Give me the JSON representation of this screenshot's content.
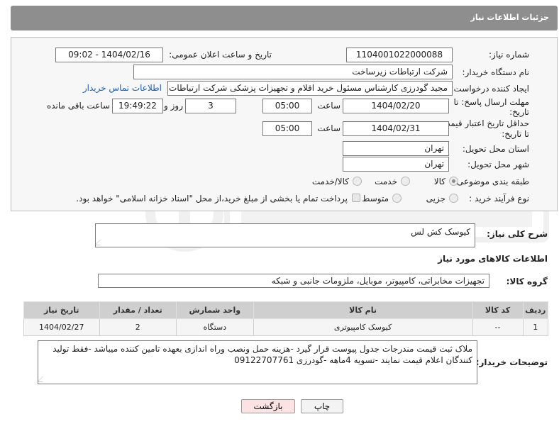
{
  "header": {
    "title": "جزئیات اطلاعات نیاز"
  },
  "form": {
    "need_number_label": "شماره نیاز:",
    "need_number": "1104001022000088",
    "announce_label": "تاریخ و ساعت اعلان عمومی:",
    "announce_value": "1404/02/16 - 09:02",
    "buyer_org_label": "نام دستگاه خریدار:",
    "buyer_org": "شرکت ارتباطات زیرساخت",
    "creator_label": "ایجاد کننده درخواست:",
    "creator": "مجید گودرزی کارشناس مسئول خرید اقلام و تجهیزات پزشکی شرکت ارتباطات ز",
    "contact_link": "اطلاعات تماس خریدار",
    "reply_deadline_label_1": "مهلت ارسال پاسخ: تا",
    "reply_deadline_label_2": "تاریخ:",
    "reply_date": "1404/02/20",
    "time_label": "ساعت",
    "reply_time": "05:00",
    "days_value": "3",
    "days_label": "روز و",
    "remaining_time": "19:49:22",
    "remaining_label": "ساعت باقی مانده",
    "price_validity_label_1": "حداقل تاریخ اعتبار قیمت:",
    "price_validity_label_2": "تا تاریخ:",
    "price_date": "1404/02/31",
    "price_time": "05:00",
    "province_label": "استان محل تحویل:",
    "province": "تهران",
    "city_label": "شهر محل تحویل:",
    "city": "تهران",
    "category_label": "طبقه بندی موضوعی:",
    "category_options": [
      "کالا",
      "خدمت",
      "کالا/خدمت"
    ],
    "process_label": "نوع فرآیند خرید :",
    "process_options": [
      "جزیی",
      "متوسط"
    ],
    "payment_note": "پرداخت تمام یا بخشی از مبلغ خرید،از محل \"اسناد خزانه اسلامی\" خواهد بود."
  },
  "description": {
    "label": "شرح کلی نیاز:",
    "value": "کیوسک  کش لس"
  },
  "goods": {
    "section_title": "اطلاعات کالاهای مورد نیاز",
    "group_label": "گروه کالا:",
    "group_value": "تجهیزات مخابراتی، کامپیوتر، موبایل، ملزومات جانبی و شبکه",
    "columns": [
      "ردیف",
      "کد کالا",
      "نام کالا",
      "واحد شمارش",
      "تعداد / مقدار",
      "تاریخ نیاز"
    ],
    "rows": [
      [
        "1",
        "--",
        "کیوسک کامپیوتری",
        "دستگاه",
        "2",
        "1404/02/27"
      ]
    ]
  },
  "buyer_notes": {
    "label": "توضیحات خریدار:",
    "value": "ملاک ثبت قیمت مندرجات جدول پیوست قرار گیرد -هزینه حمل ونصب وراه اندازی بعهده تامین کننده میباشد -فقط تولید کنندگان اعلام قیمت نمایند -تسویه 4ماهه -گودرزی 09122707761"
  },
  "buttons": {
    "print": "چاپ",
    "back": "بازگشت"
  }
}
